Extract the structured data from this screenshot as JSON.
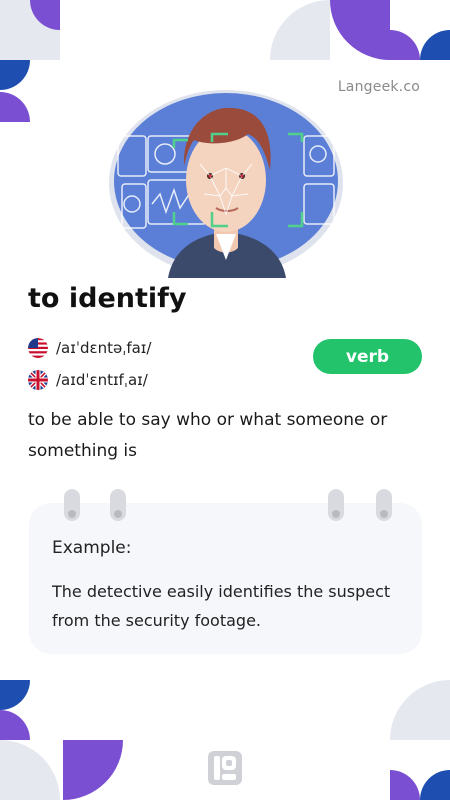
{
  "brand": {
    "text": "Langeek.co"
  },
  "entry": {
    "word": "to identify",
    "part_of_speech": "verb",
    "pronunciations": [
      {
        "region": "US",
        "flag": "us-flag-icon",
        "ipa": "/aɪˈdɛntəˌfaɪ/"
      },
      {
        "region": "UK",
        "flag": "uk-flag-icon",
        "ipa": "/aɪdˈɛntɪfˌaɪ/"
      }
    ],
    "definition": "to be able to say who or what someone or something is"
  },
  "example": {
    "label": "Example:",
    "text": "The detective easily identifies the suspect from the security footage."
  },
  "icons": {
    "illustration": "face-recognition-illustration",
    "logo": "langeek-logo-icon"
  },
  "colors": {
    "accent_purple": "#7b4fd1",
    "accent_blue": "#1e4fb0",
    "verb_badge": "#22c36b",
    "card_bg": "#f6f7fb",
    "deco_gray": "#e6e8f0"
  }
}
